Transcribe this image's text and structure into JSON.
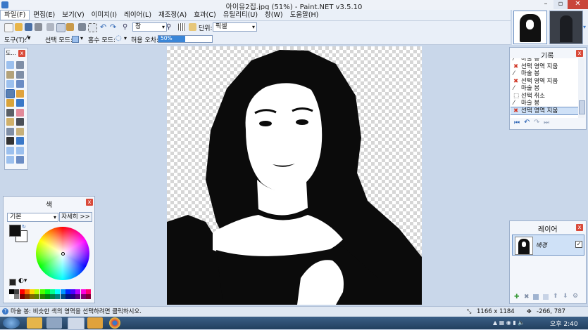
{
  "window": {
    "title": "아이유2집.jpg (51%) - Paint.NET v3.5.10",
    "min": "–",
    "max": "▫",
    "close": "✕"
  },
  "menu": [
    "파일(F)",
    "편집(E)",
    "보기(V)",
    "이미지(I)",
    "레이어(L)",
    "재조정(A)",
    "효과(C)",
    "유틸리티(U)",
    "창(W)",
    "도움말(H)"
  ],
  "toolbar": {
    "zoom_value": "창",
    "units_label": "단위:",
    "units_value": "픽셀"
  },
  "toolbar2": {
    "tool_label": "도구(T):",
    "selection_mode_label": "선택 모드:",
    "flood_mode_label": "홍수 모드:",
    "tolerance_label": "허용 오차:",
    "tolerance_value": "50%",
    "tolerance": 0.5
  },
  "tools_panel": {
    "title": "도...",
    "close": "x"
  },
  "history_panel": {
    "title": "기록",
    "close": "x",
    "items": [
      {
        "label": "마술 봉",
        "icon": "magic-wand"
      },
      {
        "label": "선택 영역 지움",
        "icon": "delete-x"
      },
      {
        "label": "마술 봉",
        "icon": "magic-wand"
      },
      {
        "label": "선택 영역 지움",
        "icon": "delete-x"
      },
      {
        "label": "마술 봉",
        "icon": "magic-wand"
      },
      {
        "label": "선택 취소",
        "icon": "deselect"
      },
      {
        "label": "마술 봉",
        "icon": "magic-wand"
      },
      {
        "label": "선택 영역 지움",
        "icon": "delete-x"
      }
    ]
  },
  "colors_panel": {
    "title": "색",
    "close": "x",
    "palette_select": "기본",
    "more_button": "자세히 >>",
    "primary": "#111111",
    "secondary": "#ffffff"
  },
  "layers_panel": {
    "title": "레이어",
    "close": "x",
    "layer_name": "배경",
    "layer_visible": true
  },
  "status": {
    "hint": "마술 봉: 비슷한 색의 영역을 선택하려면 클릭하시오.",
    "image_size": "1166 x 1184",
    "cursor_pos": "-266, 787"
  },
  "taskbar": {
    "clock": "오후 2:40"
  },
  "colors": {
    "accent": "#3a78c8",
    "close_red": "#d94a3a"
  }
}
